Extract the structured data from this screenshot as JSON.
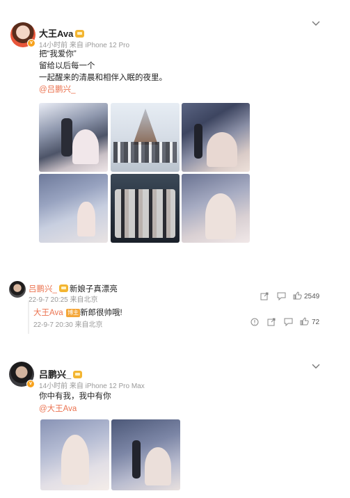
{
  "post1": {
    "author": "大王Ava",
    "meta": "14小时前  来自 iPhone 12 Pro",
    "lines": [
      "把“我爱你”",
      "留给以后每一个",
      "一起醒来的清晨和相伴入眠的夜里。"
    ],
    "mention": "@吕鹏兴_"
  },
  "comment": {
    "author": "吕鹏兴_",
    "text": "新娘子真漂亮",
    "time": "22-9-7 20:25 来自北京",
    "like_count": "2549",
    "reply": {
      "author": "大王Ava",
      "tag": "博主",
      "text": "新郎很帅哦!",
      "time": "22-9-7 20:30 来自北京",
      "like_count": "72"
    }
  },
  "post2": {
    "author": "吕鹏兴_",
    "meta": "14小时前  来自 iPhone 12 Pro Max",
    "text": "你中有我，我中有你",
    "mention": "@大王Ava"
  },
  "colors": {
    "accent": "#eb7350",
    "vip": "#f7a21d"
  }
}
